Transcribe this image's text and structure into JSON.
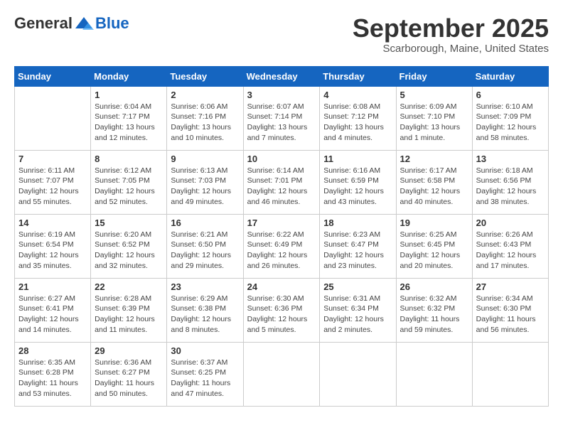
{
  "header": {
    "logo_general": "General",
    "logo_blue": "Blue",
    "month_title": "September 2025",
    "location": "Scarborough, Maine, United States"
  },
  "days_of_week": [
    "Sunday",
    "Monday",
    "Tuesday",
    "Wednesday",
    "Thursday",
    "Friday",
    "Saturday"
  ],
  "weeks": [
    [
      {
        "day": "",
        "detail": ""
      },
      {
        "day": "1",
        "detail": "Sunrise: 6:04 AM\nSunset: 7:17 PM\nDaylight: 13 hours\nand 12 minutes."
      },
      {
        "day": "2",
        "detail": "Sunrise: 6:06 AM\nSunset: 7:16 PM\nDaylight: 13 hours\nand 10 minutes."
      },
      {
        "day": "3",
        "detail": "Sunrise: 6:07 AM\nSunset: 7:14 PM\nDaylight: 13 hours\nand 7 minutes."
      },
      {
        "day": "4",
        "detail": "Sunrise: 6:08 AM\nSunset: 7:12 PM\nDaylight: 13 hours\nand 4 minutes."
      },
      {
        "day": "5",
        "detail": "Sunrise: 6:09 AM\nSunset: 7:10 PM\nDaylight: 13 hours\nand 1 minute."
      },
      {
        "day": "6",
        "detail": "Sunrise: 6:10 AM\nSunset: 7:09 PM\nDaylight: 12 hours\nand 58 minutes."
      }
    ],
    [
      {
        "day": "7",
        "detail": "Sunrise: 6:11 AM\nSunset: 7:07 PM\nDaylight: 12 hours\nand 55 minutes."
      },
      {
        "day": "8",
        "detail": "Sunrise: 6:12 AM\nSunset: 7:05 PM\nDaylight: 12 hours\nand 52 minutes."
      },
      {
        "day": "9",
        "detail": "Sunrise: 6:13 AM\nSunset: 7:03 PM\nDaylight: 12 hours\nand 49 minutes."
      },
      {
        "day": "10",
        "detail": "Sunrise: 6:14 AM\nSunset: 7:01 PM\nDaylight: 12 hours\nand 46 minutes."
      },
      {
        "day": "11",
        "detail": "Sunrise: 6:16 AM\nSunset: 6:59 PM\nDaylight: 12 hours\nand 43 minutes."
      },
      {
        "day": "12",
        "detail": "Sunrise: 6:17 AM\nSunset: 6:58 PM\nDaylight: 12 hours\nand 40 minutes."
      },
      {
        "day": "13",
        "detail": "Sunrise: 6:18 AM\nSunset: 6:56 PM\nDaylight: 12 hours\nand 38 minutes."
      }
    ],
    [
      {
        "day": "14",
        "detail": "Sunrise: 6:19 AM\nSunset: 6:54 PM\nDaylight: 12 hours\nand 35 minutes."
      },
      {
        "day": "15",
        "detail": "Sunrise: 6:20 AM\nSunset: 6:52 PM\nDaylight: 12 hours\nand 32 minutes."
      },
      {
        "day": "16",
        "detail": "Sunrise: 6:21 AM\nSunset: 6:50 PM\nDaylight: 12 hours\nand 29 minutes."
      },
      {
        "day": "17",
        "detail": "Sunrise: 6:22 AM\nSunset: 6:49 PM\nDaylight: 12 hours\nand 26 minutes."
      },
      {
        "day": "18",
        "detail": "Sunrise: 6:23 AM\nSunset: 6:47 PM\nDaylight: 12 hours\nand 23 minutes."
      },
      {
        "day": "19",
        "detail": "Sunrise: 6:25 AM\nSunset: 6:45 PM\nDaylight: 12 hours\nand 20 minutes."
      },
      {
        "day": "20",
        "detail": "Sunrise: 6:26 AM\nSunset: 6:43 PM\nDaylight: 12 hours\nand 17 minutes."
      }
    ],
    [
      {
        "day": "21",
        "detail": "Sunrise: 6:27 AM\nSunset: 6:41 PM\nDaylight: 12 hours\nand 14 minutes."
      },
      {
        "day": "22",
        "detail": "Sunrise: 6:28 AM\nSunset: 6:39 PM\nDaylight: 12 hours\nand 11 minutes."
      },
      {
        "day": "23",
        "detail": "Sunrise: 6:29 AM\nSunset: 6:38 PM\nDaylight: 12 hours\nand 8 minutes."
      },
      {
        "day": "24",
        "detail": "Sunrise: 6:30 AM\nSunset: 6:36 PM\nDaylight: 12 hours\nand 5 minutes."
      },
      {
        "day": "25",
        "detail": "Sunrise: 6:31 AM\nSunset: 6:34 PM\nDaylight: 12 hours\nand 2 minutes."
      },
      {
        "day": "26",
        "detail": "Sunrise: 6:32 AM\nSunset: 6:32 PM\nDaylight: 11 hours\nand 59 minutes."
      },
      {
        "day": "27",
        "detail": "Sunrise: 6:34 AM\nSunset: 6:30 PM\nDaylight: 11 hours\nand 56 minutes."
      }
    ],
    [
      {
        "day": "28",
        "detail": "Sunrise: 6:35 AM\nSunset: 6:28 PM\nDaylight: 11 hours\nand 53 minutes."
      },
      {
        "day": "29",
        "detail": "Sunrise: 6:36 AM\nSunset: 6:27 PM\nDaylight: 11 hours\nand 50 minutes."
      },
      {
        "day": "30",
        "detail": "Sunrise: 6:37 AM\nSunset: 6:25 PM\nDaylight: 11 hours\nand 47 minutes."
      },
      {
        "day": "",
        "detail": ""
      },
      {
        "day": "",
        "detail": ""
      },
      {
        "day": "",
        "detail": ""
      },
      {
        "day": "",
        "detail": ""
      }
    ]
  ]
}
